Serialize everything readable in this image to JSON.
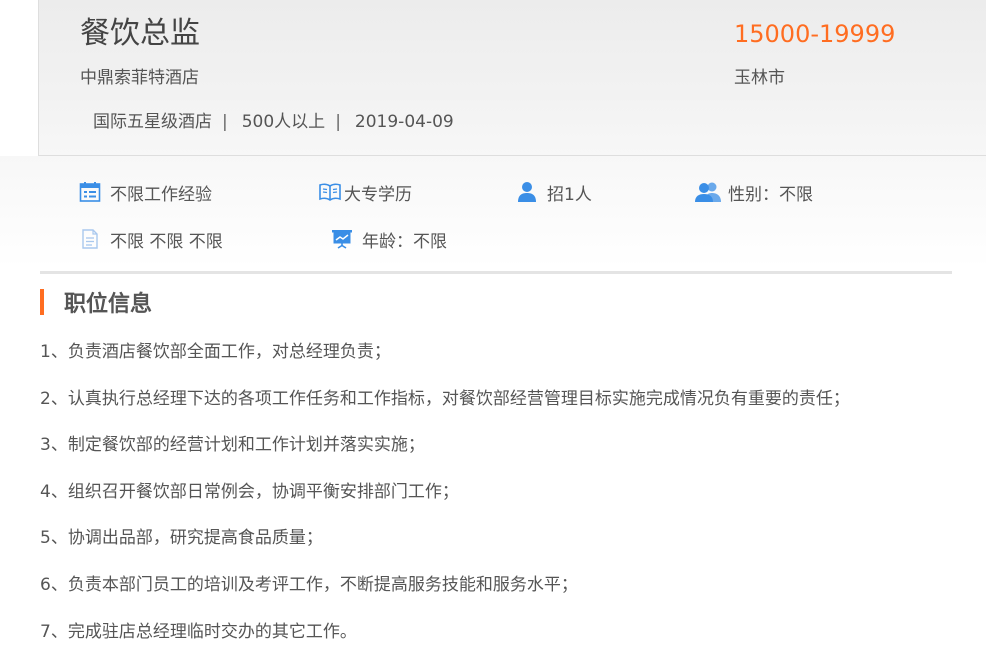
{
  "job": {
    "title": "餐饮总监",
    "salary": "15000-19999",
    "company": "中鼎索菲特酒店",
    "city": "玉林市",
    "company_type": "国际五星级酒店",
    "company_size": "500人以上",
    "post_date": "2019-04-09",
    "separator": "|"
  },
  "requirements": [
    {
      "icon": "calendar-list-icon",
      "label": "不限工作经验"
    },
    {
      "icon": "book-icon",
      "label": "大专学历"
    },
    {
      "icon": "user-icon",
      "label": "招1人"
    },
    {
      "icon": "users-icon",
      "label": "性别：不限"
    },
    {
      "icon": "document-icon",
      "label": "不限 不限 不限"
    },
    {
      "icon": "presentation-board-icon",
      "label": "年龄：不限"
    }
  ],
  "section": {
    "title": "职位信息"
  },
  "duties": [
    "1、负责酒店餐饮部全面工作，对总经理负责；",
    "2、认真执行总经理下达的各项工作任务和工作指标，对餐饮部经营管理目标实施完成情况负有重要的责任；",
    "3、制定餐饮部的经营计划和工作计划并落实实施；",
    "4、组织召开餐饮部日常例会，协调平衡安排部门工作；",
    "5、协调出品部，研究提高食品质量；",
    "6、负责本部门员工的培训及考评工作，不断提高服务技能和服务水平；",
    "7、完成驻店总经理临时交办的其它工作。"
  ],
  "colors": {
    "accent": "#ff6d21",
    "icon_blue": "#3a8ee6",
    "text": "#555555"
  }
}
